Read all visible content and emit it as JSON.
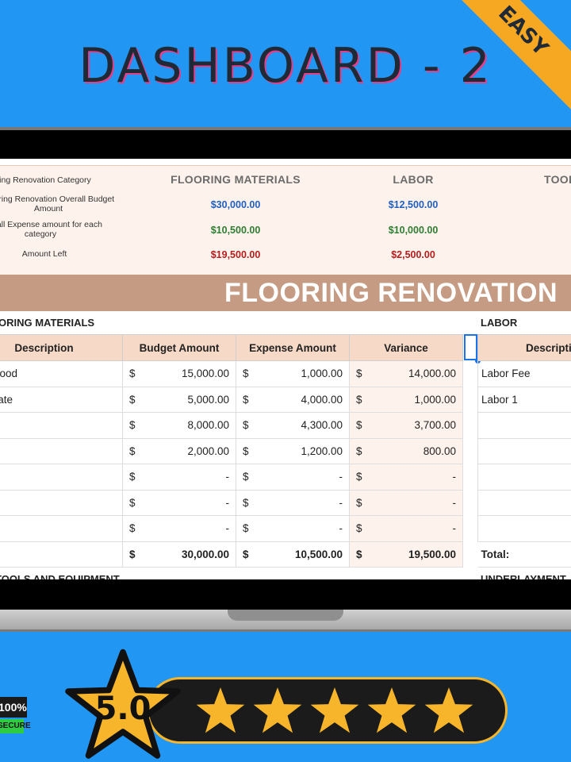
{
  "title": "DASHBOARD - 2",
  "ribbon": "EASY",
  "summary": {
    "row_labels": [
      "Flooring Renovation Category",
      "Flooring Renovation Overall Budget Amount",
      "Overall Expense amount for each category",
      "Amount Left"
    ],
    "categories": [
      {
        "name": "FLOORING MATERIALS",
        "budget": "$30,000.00",
        "expense": "$10,500.00",
        "left": "$19,500.00"
      },
      {
        "name": "LABOR",
        "budget": "$12,500.00",
        "expense": "$10,000.00",
        "left": "$2,500.00"
      },
      {
        "name": "TOOLS",
        "budget": "",
        "expense": "",
        "left": ""
      }
    ]
  },
  "banner": "FLOORING RENOVATION",
  "materials": {
    "title": "FLOORING MATERIALS",
    "headers": [
      "Description",
      "Budget Amount",
      "Expense Amount",
      "Variance"
    ],
    "currency": "$",
    "rows": [
      {
        "desc": "Hardwood",
        "budget": "15,000.00",
        "expense": "1,000.00",
        "variance": "14,000.00"
      },
      {
        "desc": "Laminate",
        "budget": "5,000.00",
        "expense": "4,000.00",
        "variance": "1,000.00"
      },
      {
        "desc": "",
        "budget": "8,000.00",
        "expense": "4,300.00",
        "variance": "3,700.00"
      },
      {
        "desc": "",
        "budget": "2,000.00",
        "expense": "1,200.00",
        "variance": "800.00"
      },
      {
        "desc": "",
        "budget": "-",
        "expense": "-",
        "variance": "-"
      },
      {
        "desc": "",
        "budget": "-",
        "expense": "-",
        "variance": "-"
      },
      {
        "desc": "",
        "budget": "-",
        "expense": "-",
        "variance": "-"
      }
    ],
    "total": {
      "desc": "",
      "budget": "30,000.00",
      "expense": "10,500.00",
      "variance": "19,500.00"
    }
  },
  "labor": {
    "title": "LABOR",
    "header": "Description",
    "rows": [
      "Labor Fee",
      "Labor 1",
      "",
      "",
      "",
      "",
      ""
    ],
    "total_label": "Total:"
  },
  "lower_titles": [
    "TOOLS AND EQUIPMENT",
    "UNDERLAYMENT"
  ],
  "rating": {
    "score": "5.0",
    "stars": 5
  },
  "badge": {
    "top": "100%",
    "bottom": "SECURE"
  },
  "colors": {
    "background": "#2196f3",
    "ribbon": "#f7a823",
    "star": "#f7b52b",
    "banner": "#c59c83"
  }
}
